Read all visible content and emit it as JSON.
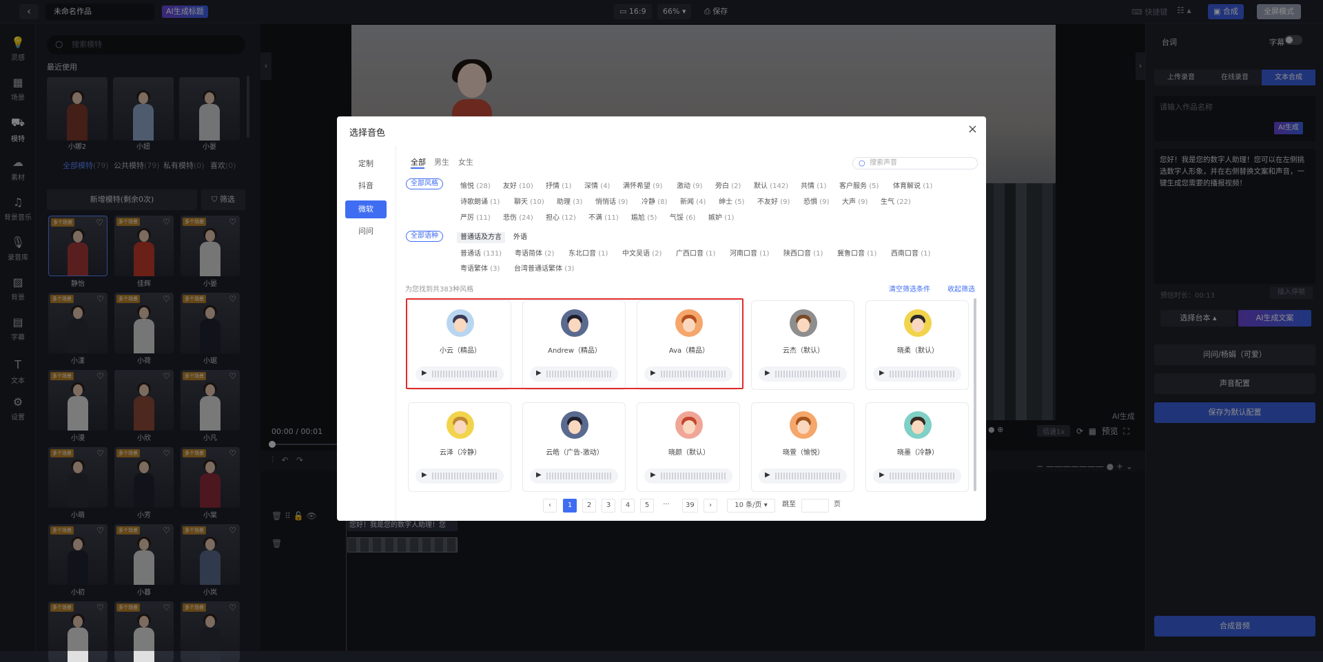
{
  "topbar": {
    "back_icon": "chevron-left-icon",
    "project_name": "未命名作品",
    "ai_title": "AI生成标题",
    "ratio": "16:9",
    "zoom": "66%",
    "save": "保存",
    "shortcut": "快捷键",
    "compose": "合成",
    "fullscreen": "全屏模式"
  },
  "nav": [
    {
      "label": "灵感",
      "icon": "bulb-icon"
    },
    {
      "label": "场景",
      "icon": "scene-icon"
    },
    {
      "label": "模特",
      "icon": "model-icon"
    },
    {
      "label": "素材",
      "icon": "cloud-icon"
    },
    {
      "label": "背景音乐",
      "icon": "music-icon"
    },
    {
      "label": "录音库",
      "icon": "mic-icon"
    },
    {
      "label": "背景",
      "icon": "background-icon"
    },
    {
      "label": "字幕",
      "icon": "subtitle-icon"
    },
    {
      "label": "文本",
      "icon": "text-icon"
    },
    {
      "label": "设置",
      "icon": "gear-icon"
    }
  ],
  "library": {
    "search_placeholder": "搜索模特",
    "recent_title": "最近使用",
    "recent": [
      "小娜2",
      "小妞",
      "小晏"
    ],
    "tabs": [
      {
        "label": "全部模特",
        "count": "(79)"
      },
      {
        "label": "公共模特",
        "count": "(79)"
      },
      {
        "label": "私有模特",
        "count": "(0)"
      },
      {
        "label": "喜欢",
        "count": "(0)"
      }
    ],
    "add_model": "新增模特(剩余0次)",
    "filter": "筛选",
    "tag": "多个场景",
    "models": [
      "静怡",
      "佳辉",
      "小晏",
      "小漾",
      "小荷",
      "小琚",
      "小漫",
      "小欣",
      "小凡",
      "小萌",
      "小芳",
      "小棠",
      "小初",
      "小暮",
      "小岚",
      "",
      "",
      ""
    ]
  },
  "player": {
    "time": "00:00 / 00:01",
    "ai_badge": "AI生成",
    "speed": "倍速1x",
    "preview": "预览"
  },
  "timeline": {
    "text_clip": "您好！我是您的数字人助理！您"
  },
  "right_panel": {
    "title": "台词",
    "subtitle_label": "字幕",
    "tabs": [
      "上传录音",
      "在线录音",
      "文本合成"
    ],
    "name_placeholder": "请输入作品名称",
    "ai_gen": "AI生成",
    "script_text": "您好！我是您的数字人助理！您可以在左侧挑选数字人形象，并在右侧替换文案和声音，一键生成您需要的播报视频！",
    "duration": "预估时长：00:13",
    "insert_pause": "插入停顿",
    "select_script": "选择台本",
    "ai_write": "AI生成文案",
    "voice_name": "问问/杨娟（可爱）",
    "voice_config": "声音配置",
    "save_default": "保存为默认配置",
    "compose_audio": "合成音频"
  },
  "modal": {
    "title": "选择音色",
    "side": [
      "定制",
      "抖音",
      "微软",
      "问问"
    ],
    "gender_tabs": [
      "全部",
      "男生",
      "女生"
    ],
    "search_placeholder": "搜索声音",
    "style_all": "全部风格",
    "styles": [
      {
        "name": "愉悦",
        "count": "(28)"
      },
      {
        "name": "友好",
        "count": "(10)"
      },
      {
        "name": "抒情",
        "count": "(1)"
      },
      {
        "name": "深情",
        "count": "(4)"
      },
      {
        "name": "满怀希望",
        "count": "(9)"
      },
      {
        "name": "激动",
        "count": "(9)"
      },
      {
        "name": "旁白",
        "count": "(2)"
      },
      {
        "name": "默认",
        "count": "(142)"
      },
      {
        "name": "共情",
        "count": "(1)"
      },
      {
        "name": "客户服务",
        "count": "(5)"
      },
      {
        "name": "体育解说",
        "count": "(1)"
      },
      {
        "name": "诗歌朗诵",
        "count": "(1)"
      },
      {
        "name": "聊天",
        "count": "(10)"
      },
      {
        "name": "助理",
        "count": "(3)"
      },
      {
        "name": "悄悄话",
        "count": "(9)"
      },
      {
        "name": "冷静",
        "count": "(8)"
      },
      {
        "name": "新闻",
        "count": "(4)"
      },
      {
        "name": "绅士",
        "count": "(5)"
      },
      {
        "name": "不友好",
        "count": "(9)"
      },
      {
        "name": "恐惧",
        "count": "(9)"
      },
      {
        "name": "大声",
        "count": "(9)"
      },
      {
        "name": "生气",
        "count": "(22)"
      },
      {
        "name": "严厉",
        "count": "(11)"
      },
      {
        "name": "悲伤",
        "count": "(24)"
      },
      {
        "name": "担心",
        "count": "(12)"
      },
      {
        "name": "不满",
        "count": "(11)"
      },
      {
        "name": "尴尬",
        "count": "(5)"
      },
      {
        "name": "气馁",
        "count": "(6)"
      },
      {
        "name": "嫉妒",
        "count": "(1)"
      }
    ],
    "lang_all": "全部语种",
    "lang_tabs": [
      "普通话及方言",
      "外语"
    ],
    "langs": [
      {
        "name": "普通话",
        "count": "(131)"
      },
      {
        "name": "粤语简体",
        "count": "(2)"
      },
      {
        "name": "东北口音",
        "count": "(1)"
      },
      {
        "name": "中文吴语",
        "count": "(2)"
      },
      {
        "name": "广西口音",
        "count": "(1)"
      },
      {
        "name": "河南口音",
        "count": "(1)"
      },
      {
        "name": "陕西口音",
        "count": "(1)"
      },
      {
        "name": "冀鲁口音",
        "count": "(1)"
      },
      {
        "name": "西南口音",
        "count": "(1)"
      },
      {
        "name": "粤语繁体",
        "count": "(3)"
      },
      {
        "name": "台湾普通话繁体",
        "count": "(3)"
      }
    ],
    "found": "为您找到共383种风格",
    "clear": "清空筛选条件",
    "collapse": "收起筛选",
    "voices": [
      {
        "name": "小云（精品）",
        "hair": "#3d3a56",
        "bg": "#b9d6f0"
      },
      {
        "name": "Andrew（精品）",
        "hair": "#1f1f2b",
        "bg": "#5a6a8f"
      },
      {
        "name": "Ava（精品）",
        "hair": "#b5501f",
        "bg": "#f5a66a"
      },
      {
        "name": "云杰（默认）",
        "hair": "#7a4a25",
        "bg": "#8e8e8e"
      },
      {
        "name": "晓柔（默认）",
        "hair": "#2a2a2a",
        "bg": "#f2d44c"
      },
      {
        "name": "云泽（冷静）",
        "hair": "#c08a35",
        "bg": "#f2d44c"
      },
      {
        "name": "云皓（广告-激动）",
        "hair": "#1f1f2b",
        "bg": "#5a6a8f"
      },
      {
        "name": "晓颜（默认）",
        "hair": "#c2462d",
        "bg": "#f0a696"
      },
      {
        "name": "晓萱（愉悦）",
        "hair": "#a2531e",
        "bg": "#f5a66a"
      },
      {
        "name": "晓墨（冷静）",
        "hair": "#3b2a20",
        "bg": "#7fd0c6"
      }
    ],
    "pages": [
      "1",
      "2",
      "3",
      "4",
      "5",
      "···",
      "39"
    ],
    "page_size": "10 条/页",
    "jump": "跳至",
    "page_unit": "页"
  }
}
